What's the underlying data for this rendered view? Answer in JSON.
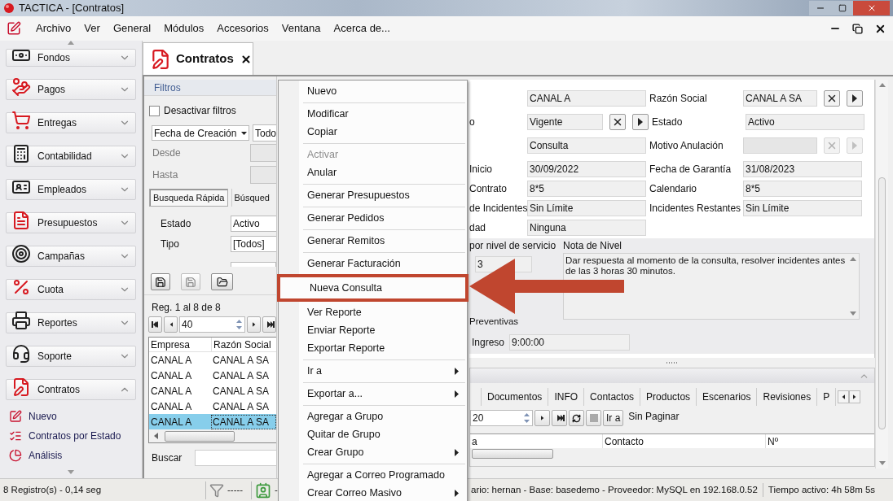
{
  "window": {
    "title": "TACTICA - [Contratos]"
  },
  "menu_bar": [
    "Archivo",
    "Ver",
    "General",
    "Módulos",
    "Accesorios",
    "Ventana",
    "Acerca de..."
  ],
  "sidebar": {
    "items": [
      {
        "label": "Fondos",
        "expanded": false
      },
      {
        "label": "Pagos",
        "expanded": false
      },
      {
        "label": "Entregas",
        "expanded": false
      },
      {
        "label": "Contabilidad",
        "expanded": false
      },
      {
        "label": "Empleados",
        "expanded": false
      },
      {
        "label": "Presupuestos",
        "expanded": false
      },
      {
        "label": "Campañas",
        "expanded": false
      },
      {
        "label": "Cuota",
        "expanded": false
      },
      {
        "label": "Reportes",
        "expanded": false
      },
      {
        "label": "Soporte",
        "expanded": false
      },
      {
        "label": "Contratos",
        "expanded": true,
        "children": [
          {
            "label": "Nuevo"
          },
          {
            "label": "Contratos por Estado"
          },
          {
            "label": "Análisis"
          }
        ]
      }
    ]
  },
  "document_tab": {
    "label": "Contratos"
  },
  "filters": {
    "title": "Filtros",
    "disable_filters": {
      "label": "Desactivar filtros",
      "checked": false
    },
    "date_field": "Fecha de Creación",
    "date_range": "Todo",
    "from_label": "Desde",
    "to_label": "Hasta",
    "search_tabs": [
      {
        "label": "Busqueda Rápida",
        "selected": true
      },
      {
        "label": "Búsqued",
        "selected": false
      }
    ],
    "fields": [
      {
        "label": "Estado",
        "value": "Activo"
      },
      {
        "label": "Tipo",
        "value": "[Todos]"
      }
    ]
  },
  "results": {
    "summary": "Reg. 1 al 8 de 8",
    "page_size": "40",
    "columns": [
      "Empresa",
      "Razón Social"
    ],
    "rows": [
      {
        "cells": [
          "CANAL A",
          "CANAL A SA"
        ],
        "selected": false
      },
      {
        "cells": [
          "CANAL A",
          "CANAL A SA"
        ],
        "selected": false
      },
      {
        "cells": [
          "CANAL A",
          "CANAL A SA"
        ],
        "selected": false
      },
      {
        "cells": [
          "CANAL A",
          "CANAL A SA"
        ],
        "selected": false
      },
      {
        "cells": [
          "CANAL A",
          "CANAL A SA"
        ],
        "selected": true
      }
    ],
    "search_label": "Buscar"
  },
  "detail": {
    "rows": [
      [
        {
          "value": "CANAL A"
        },
        {
          "label": "Razón Social",
          "value": "CANAL A SA",
          "lookup": true,
          "disabled": false
        }
      ],
      [
        {
          "label": "o",
          "value": "Vigente",
          "lookup": true,
          "disabled": false
        },
        {
          "label": "Estado",
          "value": "Activo"
        }
      ],
      [
        {
          "value": "Consulta"
        },
        {
          "label": "Motivo Anulación",
          "lookup": true,
          "disabled": true
        }
      ],
      [
        {
          "label": "Inicio",
          "value": "30/09/2022"
        },
        {
          "label": "Fecha de Garantía",
          "value": "31/08/2023"
        }
      ],
      [
        {
          "label": "Contrato",
          "value": "8*5"
        },
        {
          "label": "Calendario",
          "value": "8*5"
        }
      ],
      [
        {
          "label": "de Incidentes",
          "value": "Sin Límite"
        },
        {
          "label": "Incidentes Restantes",
          "value": "Sin Límite"
        }
      ],
      [
        {
          "label": "dad",
          "value": "Ninguna"
        }
      ]
    ],
    "service_level_label": "por nivel de servicio",
    "service_level_value": "3",
    "note_label": "Nota de Nivel",
    "note": "Dar respuesta al momento de la consulta, resolver incidentes antes de las 3 horas 30 minutos.",
    "preventive_label": "Preventivas",
    "entry_label": "Ingreso",
    "entry_value": "9:00:00"
  },
  "bottom_panel": {
    "tabs": [
      {
        "label": "Documentos",
        "selected": false
      },
      {
        "label": "INFO",
        "selected": false
      },
      {
        "label": "Contactos",
        "selected": false
      },
      {
        "label": "Productos",
        "selected": false
      },
      {
        "label": "Escenarios",
        "selected": false
      },
      {
        "label": "Revisiones",
        "selected": false
      },
      {
        "label": "P",
        "selected": false
      }
    ],
    "page_size": "20",
    "goto_label": "Ir a",
    "paging": "Sin Paginar",
    "columns": [
      "a",
      "Contacto",
      "Nº"
    ]
  },
  "context_menu": {
    "items": [
      {
        "kind": "item",
        "label": "Nuevo",
        "disabled": false,
        "submenu": false,
        "highlighted": false
      },
      {
        "kind": "separator"
      },
      {
        "kind": "item",
        "label": "Modificar",
        "disabled": false,
        "submenu": false,
        "highlighted": false
      },
      {
        "kind": "item",
        "label": "Copiar",
        "disabled": false,
        "submenu": false,
        "highlighted": false
      },
      {
        "kind": "separator"
      },
      {
        "kind": "item",
        "label": "Activar",
        "disabled": true,
        "submenu": false,
        "highlighted": false
      },
      {
        "kind": "item",
        "label": "Anular",
        "disabled": false,
        "submenu": false,
        "highlighted": false
      },
      {
        "kind": "separator"
      },
      {
        "kind": "item",
        "label": "Generar Presupuestos",
        "disabled": false,
        "submenu": false,
        "highlighted": false
      },
      {
        "kind": "separator"
      },
      {
        "kind": "item",
        "label": "Generar Pedidos",
        "disabled": false,
        "submenu": false,
        "highlighted": false
      },
      {
        "kind": "separator"
      },
      {
        "kind": "item",
        "label": "Generar Remitos",
        "disabled": false,
        "submenu": false,
        "highlighted": false
      },
      {
        "kind": "separator"
      },
      {
        "kind": "item",
        "label": "Generar Facturación",
        "disabled": false,
        "submenu": false,
        "highlighted": false
      },
      {
        "kind": "separator"
      },
      {
        "kind": "item",
        "label": "Nueva Consulta",
        "disabled": false,
        "submenu": false,
        "highlighted": true
      },
      {
        "kind": "separator"
      },
      {
        "kind": "item",
        "label": "Ver Reporte",
        "disabled": false,
        "submenu": false,
        "highlighted": false
      },
      {
        "kind": "item",
        "label": "Enviar Reporte",
        "disabled": false,
        "submenu": false,
        "highlighted": false
      },
      {
        "kind": "item",
        "label": "Exportar Reporte",
        "disabled": false,
        "submenu": false,
        "highlighted": false
      },
      {
        "kind": "separator"
      },
      {
        "kind": "item",
        "label": "Ir a",
        "disabled": false,
        "submenu": true,
        "highlighted": false
      },
      {
        "kind": "separator"
      },
      {
        "kind": "item",
        "label": "Exportar a...",
        "disabled": false,
        "submenu": true,
        "highlighted": false
      },
      {
        "kind": "separator"
      },
      {
        "kind": "item",
        "label": "Agregar a Grupo",
        "disabled": false,
        "submenu": false,
        "highlighted": false
      },
      {
        "kind": "item",
        "label": "Quitar de Grupo",
        "disabled": false,
        "submenu": false,
        "highlighted": false
      },
      {
        "kind": "item",
        "label": "Crear Grupo",
        "disabled": false,
        "submenu": true,
        "highlighted": false
      },
      {
        "kind": "separator"
      },
      {
        "kind": "item",
        "label": "Agregar a Correo Programado",
        "disabled": false,
        "submenu": false,
        "highlighted": false
      },
      {
        "kind": "item",
        "label": "Crear Correo Masivo",
        "disabled": false,
        "submenu": true,
        "highlighted": false
      }
    ]
  },
  "status_bar": {
    "records": "8 Registro(s) - 0,14 seg",
    "filter": "-----",
    "cards": "-",
    "connection": "ario: hernan - Base: basedemo - Proveedor: MySQL en 192.168.0.52",
    "uptime": "Tiempo activo: 4h 58m 5s"
  }
}
